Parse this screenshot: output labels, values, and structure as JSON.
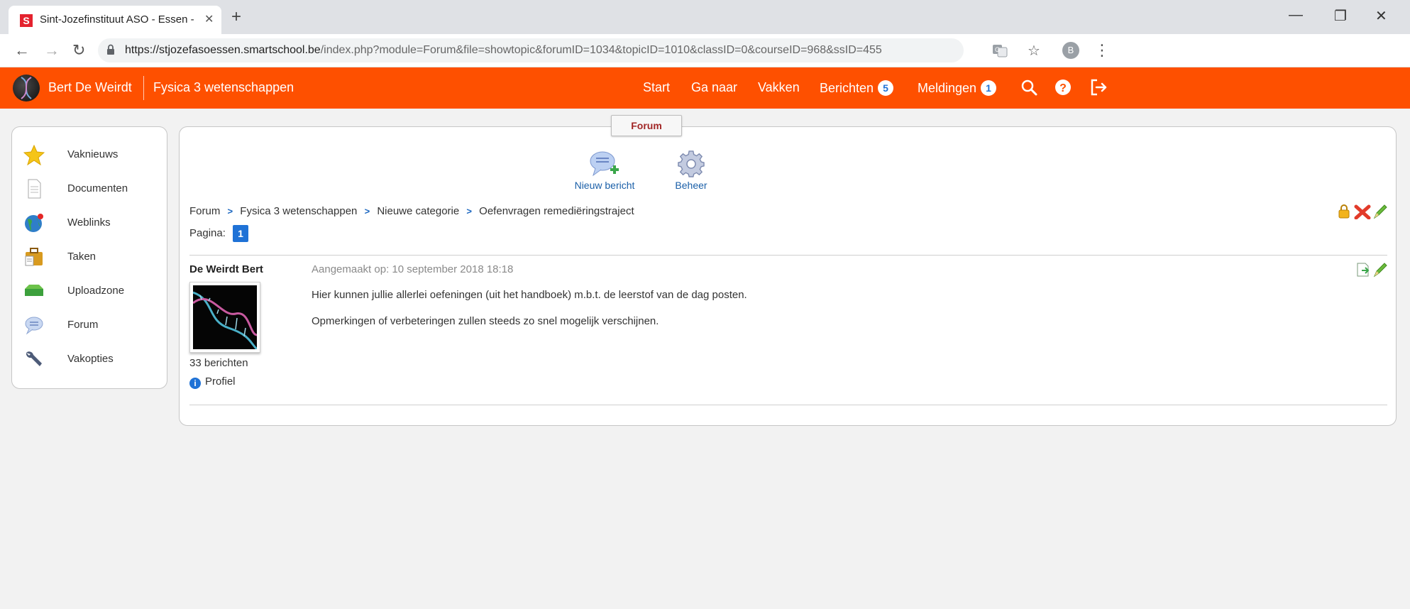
{
  "browser": {
    "tab_title": "Sint-Jozefinstituut ASO - Essen -",
    "tab_favicon_letter": "S",
    "tab_close": "✕",
    "new_tab": "+",
    "url_host": "https://stjozefasoessen.smartschool.be",
    "url_path": "/index.php?module=Forum&file=showtopic&forumID=1034&topicID=1010&classID=0&courseID=968&ssID=455",
    "profile_initial": "B",
    "window": {
      "minimize": "—",
      "restore": "❐",
      "close": "✕"
    },
    "nav": {
      "back": "←",
      "forward": "→",
      "reload": "↻"
    },
    "star": "☆",
    "menu": "⋮"
  },
  "header": {
    "user_name": "Bert De Weirdt",
    "course_name": "Fysica 3 wetenschappen",
    "nav": {
      "start": "Start",
      "goto": "Ga naar",
      "courses": "Vakken",
      "messages": "Berichten",
      "messages_count": "5",
      "notifications": "Meldingen",
      "notifications_count": "1"
    },
    "brand_color": "#fe5000"
  },
  "sidebar": {
    "items": [
      {
        "label": "Vaknieuws",
        "icon": "star-icon"
      },
      {
        "label": "Documenten",
        "icon": "document-icon"
      },
      {
        "label": "Weblinks",
        "icon": "globe-icon"
      },
      {
        "label": "Taken",
        "icon": "briefcase-icon"
      },
      {
        "label": "Uploadzone",
        "icon": "upload-tray-icon"
      },
      {
        "label": "Forum",
        "icon": "speech-bubble-icon"
      },
      {
        "label": "Vakopties",
        "icon": "wrench-icon"
      }
    ]
  },
  "main": {
    "tab_label": "Forum",
    "actions": {
      "new_message": "Nieuw bericht",
      "manage": "Beheer"
    },
    "breadcrumb": [
      "Forum",
      "Fysica 3 wetenschappen",
      "Nieuwe categorie",
      "Oefenvragen remediëringstraject"
    ],
    "pagination_label": "Pagina:",
    "current_page": "1",
    "post": {
      "author": "De Weirdt Bert",
      "created": "Aangemaakt op: 10 september 2018 18:18",
      "paragraphs": [
        "Hier kunnen jullie allerlei oefeningen (uit het handboek) m.b.t. de leerstof van de dag posten.",
        "Opmerkingen of verbeteringen zullen steeds zo snel mogelijk verschijnen."
      ],
      "post_count": "33 berichten",
      "profile_label": "Profiel"
    }
  }
}
